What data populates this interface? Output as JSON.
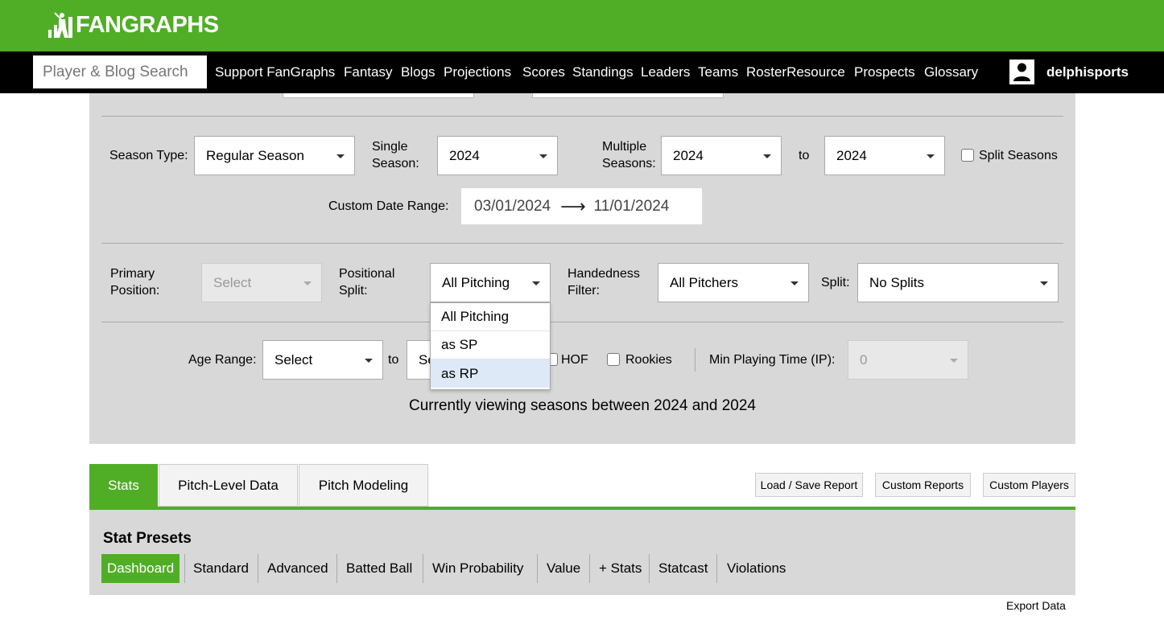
{
  "header": {
    "logo_text": "FANGRAPHS",
    "brand_color": "#50ae26"
  },
  "nav": {
    "search_placeholder": "Player & Blog Search",
    "links": [
      "Support FanGraphs",
      "Fantasy",
      "Blogs",
      "Projections",
      "Scores",
      "Standings",
      "Leaders",
      "Teams",
      "RosterResource",
      "Prospects",
      "Glossary"
    ],
    "username": "delphisports"
  },
  "filters": {
    "season_type_label": "Season Type:",
    "season_type_value": "Regular Season",
    "single_season_label_1": "Single",
    "single_season_label_2": "Season:",
    "single_season_value": "2024",
    "multiple_seasons_label_1": "Multiple",
    "multiple_seasons_label_2": "Seasons:",
    "multiple_from": "2024",
    "to_label": "to",
    "multiple_to": "2024",
    "split_seasons_label": "Split Seasons",
    "custom_date_label": "Custom Date Range:",
    "date_start": "03/01/2024",
    "date_arrow": "⟶",
    "date_end": "11/01/2024",
    "primary_position_label_1": "Primary",
    "primary_position_label_2": "Position:",
    "primary_position_value": "Select",
    "positional_split_label_1": "Positional",
    "positional_split_label_2": "Split:",
    "positional_split_value": "All Pitching",
    "handedness_label_1": "Handedness",
    "handedness_label_2": "Filter:",
    "handedness_value": "All Pitchers",
    "split_label": "Split:",
    "split_value": "No Splits",
    "age_range_label": "Age Range:",
    "age_from": "Select",
    "age_to_label": "to",
    "age_to": "Se",
    "hof_label": "HOF",
    "rookies_label": "Rookies",
    "min_playing_time_label": "Min Playing Time (IP):",
    "min_playing_time_value": "0",
    "status_text": "Currently viewing seasons between 2024 and 2024"
  },
  "dropdown": {
    "options": [
      "All Pitching",
      "as SP",
      "as RP"
    ],
    "highlighted": "as RP"
  },
  "tabs": {
    "items": [
      "Stats",
      "Pitch-Level Data",
      "Pitch Modeling"
    ],
    "active": "Stats",
    "tools": [
      "Load / Save Report",
      "Custom Reports",
      "Custom Players"
    ]
  },
  "presets": {
    "title": "Stat Presets",
    "items": [
      "Dashboard",
      "Standard",
      "Advanced",
      "Batted Ball",
      "Win Probability",
      "Value",
      "+ Stats",
      "Statcast",
      "Violations"
    ],
    "active": "Dashboard"
  },
  "export_label": "Export Data"
}
